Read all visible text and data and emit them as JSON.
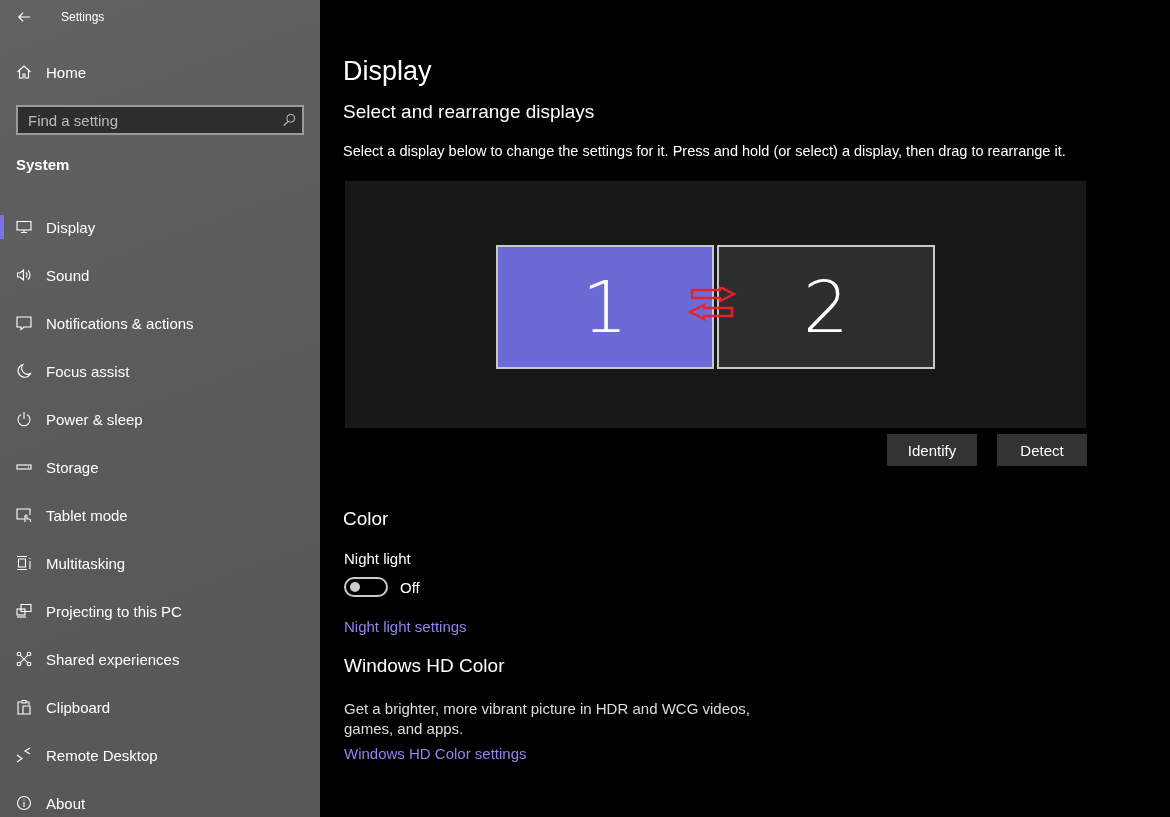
{
  "window": {
    "title": "Settings"
  },
  "sidebar": {
    "home": "Home",
    "search": {
      "placeholder": "Find a setting"
    },
    "section": "System",
    "items": [
      {
        "label": "Display",
        "selected": true
      },
      {
        "label": "Sound",
        "selected": false
      },
      {
        "label": "Notifications & actions",
        "selected": false
      },
      {
        "label": "Focus assist",
        "selected": false
      },
      {
        "label": "Power & sleep",
        "selected": false
      },
      {
        "label": "Storage",
        "selected": false
      },
      {
        "label": "Tablet mode",
        "selected": false
      },
      {
        "label": "Multitasking",
        "selected": false
      },
      {
        "label": "Projecting to this PC",
        "selected": false
      },
      {
        "label": "Shared experiences",
        "selected": false
      },
      {
        "label": "Clipboard",
        "selected": false
      },
      {
        "label": "Remote Desktop",
        "selected": false
      },
      {
        "label": "About",
        "selected": false
      }
    ]
  },
  "main": {
    "title": "Display",
    "arrange": {
      "heading": "Select and rearrange displays",
      "description": "Select a display below to change the settings for it. Press and hold (or select) a display, then drag to rearrange it.",
      "displays": [
        {
          "label": "1",
          "selected": true
        },
        {
          "label": "2",
          "selected": false
        }
      ],
      "buttons": [
        "Identify",
        "Detect"
      ]
    },
    "color": {
      "heading": "Color",
      "night_light": {
        "label": "Night light",
        "on": false,
        "state_text": "Off"
      },
      "link": "Night light settings"
    },
    "hdr": {
      "heading": "Windows HD Color",
      "description": "Get a brighter, more vibrant picture in HDR and WCG videos, games, and apps.",
      "link": "Windows HD Color settings"
    }
  }
}
